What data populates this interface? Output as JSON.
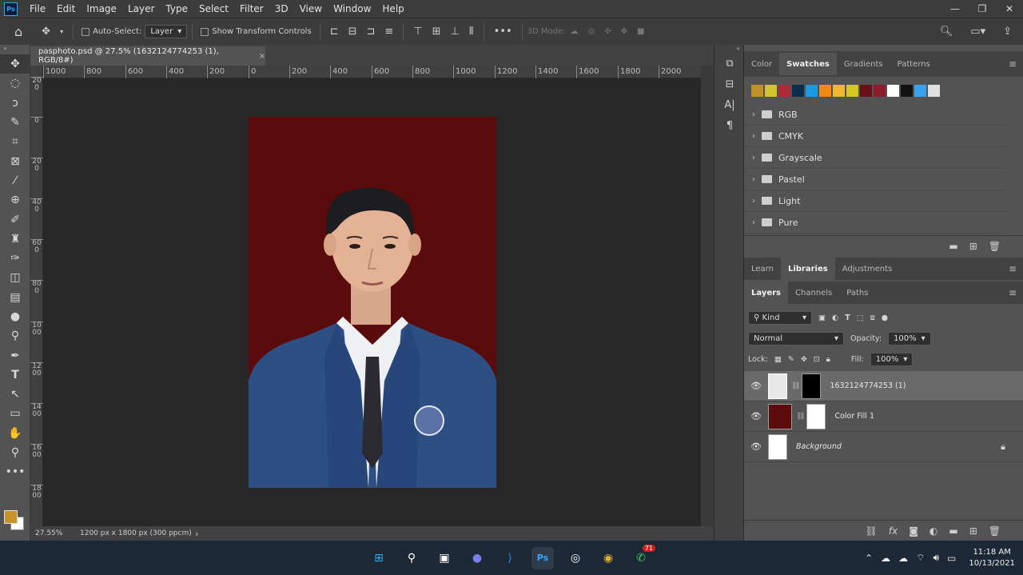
{
  "menu": {
    "logo": "Ps",
    "items": [
      "File",
      "Edit",
      "Image",
      "Layer",
      "Type",
      "Select",
      "Filter",
      "3D",
      "View",
      "Window",
      "Help"
    ]
  },
  "options": {
    "auto_select_label": "Auto-Select:",
    "auto_select_value": "Layer",
    "show_transform_label": "Show Transform Controls",
    "three_d_mode": "3D Mode:"
  },
  "document": {
    "tab_title": "pasphoto.psd @ 27.5% (1632124774253 (1), RGB/8#)",
    "close_glyph": "×",
    "ruler_h": [
      "1000",
      "800",
      "600",
      "400",
      "200",
      "0",
      "200",
      "400",
      "600",
      "800",
      "1000",
      "1200",
      "1400",
      "1600",
      "1800",
      "2000"
    ],
    "ruler_v": [
      "200",
      "0",
      "200",
      "400",
      "600",
      "800",
      "1000",
      "1200",
      "1400",
      "1600",
      "1800"
    ],
    "zoom": "27.55%",
    "info": "1200 px x 1800 px (300 ppcm)"
  },
  "swatches_panel": {
    "tabs": [
      "Color",
      "Swatches",
      "Gradients",
      "Patterns"
    ],
    "active_tab": "Swatches",
    "colors": [
      "#c09228",
      "#d4c42c",
      "#b0283a",
      "#0a2f4e",
      "#1a9ae6",
      "#f08a14",
      "#f0b830",
      "#d6c81e",
      "#6a1018",
      "#8c1c2c",
      "#ffffff",
      "#111111",
      "#3aa0f0",
      "#e0e0e0"
    ],
    "folders": [
      "RGB",
      "CMYK",
      "Grayscale",
      "Pastel",
      "Light",
      "Pure"
    ]
  },
  "libraries_panel": {
    "tabs": [
      "Learn",
      "Libraries",
      "Adjustments"
    ],
    "active_tab": "Libraries"
  },
  "layers_panel": {
    "tabs": [
      "Layers",
      "Channels",
      "Paths"
    ],
    "active_tab": "Layers",
    "kind_label": "Kind",
    "blend_mode": "Normal",
    "opacity_label": "Opacity:",
    "opacity_value": "100%",
    "lock_label": "Lock:",
    "fill_label": "Fill:",
    "fill_value": "100%",
    "layers": [
      {
        "name": "1632124774253 (1)",
        "selected": true
      },
      {
        "name": "Color Fill 1",
        "selected": false
      },
      {
        "name": "Background",
        "selected": false
      }
    ]
  },
  "taskbar": {
    "whatsapp_badge": "71",
    "time": "11:18 AM",
    "date": "10/13/2021"
  }
}
